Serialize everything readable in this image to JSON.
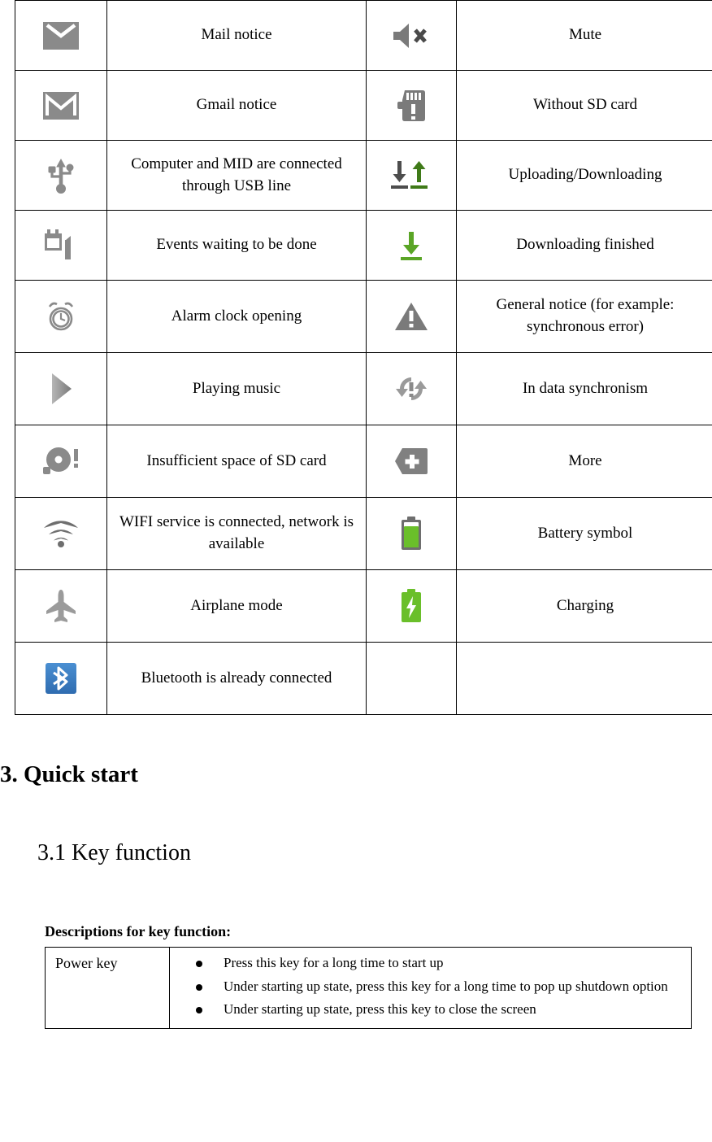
{
  "document": {
    "status_icon_table": {
      "rows": [
        {
          "left_icon": "envelope-icon",
          "left_label": "Mail notice",
          "right_icon": "speaker-mute-icon",
          "right_label": "Mute"
        },
        {
          "left_icon": "gmail-icon",
          "left_label": "Gmail notice",
          "right_icon": "sd-card-missing-icon",
          "right_label": "Without SD card"
        },
        {
          "left_icon": "usb-icon",
          "left_label": "Computer and MID are connected through USB line",
          "right_icon": "upload-download-arrows-icon",
          "right_label": "Uploading/Downloading"
        },
        {
          "left_icon": "calendar-event-icon",
          "left_label": "Events waiting to be done",
          "right_icon": "download-finished-icon",
          "right_label": "Downloading finished"
        },
        {
          "left_icon": "alarm-clock-icon",
          "left_label": "Alarm clock opening",
          "right_icon": "warning-triangle-icon",
          "right_label": "General notice (for example: synchronous error)"
        },
        {
          "left_icon": "play-icon",
          "left_label": "Playing music",
          "right_icon": "sync-error-icon",
          "right_label": "In data synchronism"
        },
        {
          "left_icon": "disc-full-icon",
          "left_label": "Insufficient space of SD card",
          "right_icon": "more-plus-icon",
          "right_label": "More"
        },
        {
          "left_icon": "wifi-icon",
          "left_label": "WIFI service is connected, network is available",
          "right_icon": "battery-icon",
          "right_label": "Battery symbol"
        },
        {
          "left_icon": "airplane-icon",
          "left_label": "Airplane mode",
          "right_icon": "battery-charging-icon",
          "right_label": "Charging"
        },
        {
          "left_icon": "bluetooth-icon",
          "left_label": "Bluetooth is already connected",
          "right_icon": "",
          "right_label": ""
        }
      ]
    },
    "headings": {
      "section": "3. Quick start",
      "subsection": "3.1 Key function"
    },
    "key_function": {
      "caption": "Descriptions for key function:",
      "rows": [
        {
          "key": "Power key",
          "items": [
            "Press this key for a long time to start up",
            "Under starting up state, press this key for a long time to pop up shutdown option",
            "Under starting up state, press this key to close the screen"
          ]
        }
      ]
    },
    "colors": {
      "icon_gray": "#8a8a8a",
      "icon_dark_gray": "#6e6e6e",
      "battery_green": "#6abf2a",
      "download_green": "#5aa526",
      "bluetooth_blue": "#3b7dc4",
      "border": "#000000"
    }
  }
}
